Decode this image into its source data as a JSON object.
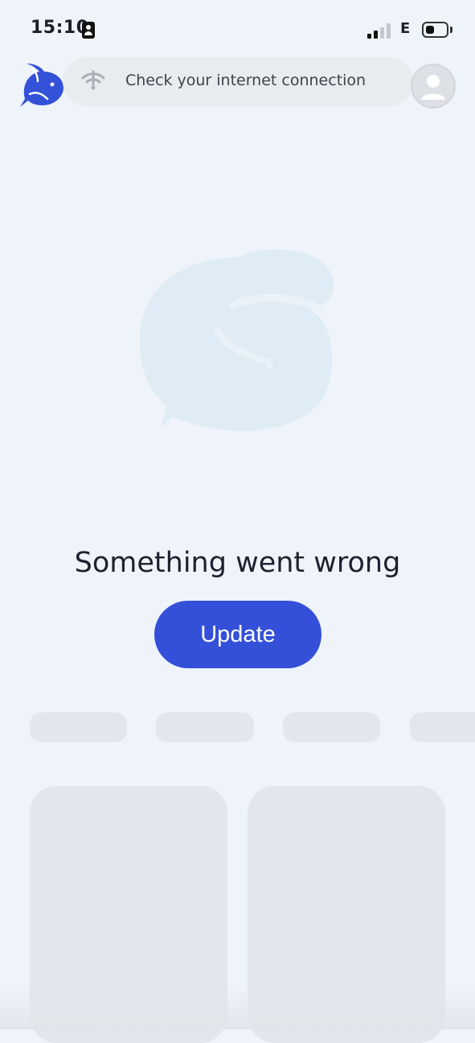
{
  "status_bar": {
    "time": "15:10",
    "network_type": "E",
    "signal_bars_active": 2,
    "signal_bars_total": 4,
    "battery_level": 0.3
  },
  "header": {
    "logo_icon": "whale-logo-icon",
    "toast": {
      "icon": "no-wifi-icon",
      "text": "Check your internet connection"
    },
    "profile_icon": "user-avatar-icon"
  },
  "main": {
    "watermark_icon": "whale-chat-bubble-icon",
    "error_title": "Something went wrong",
    "update_button_label": "Update"
  },
  "colors": {
    "accent": "#3550d8",
    "background": "#eff4fa",
    "skeleton": "#e3e7ed",
    "watermark": "#dfecf5"
  }
}
